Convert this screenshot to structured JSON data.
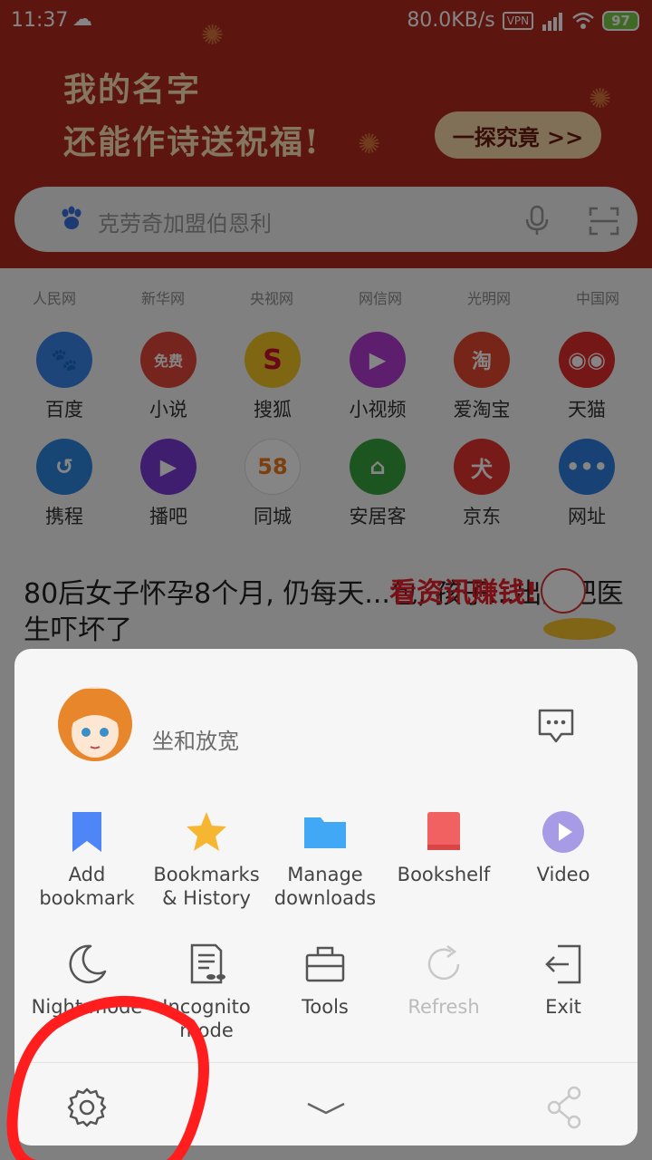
{
  "status_bar": {
    "time": "11:37",
    "speed": "80.0KB/s",
    "vpn": "VPN",
    "battery": "97"
  },
  "banner": {
    "line1": "我的名字",
    "line2": "还能作诗送祝福!",
    "button": "一探究竟 >>"
  },
  "search": {
    "placeholder": "克劳奇加盟伯恩利"
  },
  "quick_links": [
    "人民网",
    "新华网",
    "央视网",
    "网信网",
    "光明网",
    "中国网"
  ],
  "apps": [
    {
      "label": "百度",
      "color": "#3a85e8",
      "glyph": "🐾"
    },
    {
      "label": "小说",
      "color": "#e2473b",
      "glyph": "📖"
    },
    {
      "label": "搜狐",
      "color": "#f2c425",
      "glyph": "S"
    },
    {
      "label": "小视频",
      "color": "#b33ad2",
      "glyph": "▶"
    },
    {
      "label": "爱淘宝",
      "color": "#e54730",
      "glyph": "淘"
    },
    {
      "label": "天猫",
      "color": "#e02c2c",
      "glyph": "🐱"
    },
    {
      "label": "携程",
      "color": "#2e86de",
      "glyph": "🐬"
    },
    {
      "label": "播吧",
      "color": "#7a3ad6",
      "glyph": "▶"
    },
    {
      "label": "同城",
      "color": "#ffffff",
      "glyph": "58"
    },
    {
      "label": "安居客",
      "color": "#38a33e",
      "glyph": "⌂"
    },
    {
      "label": "京东",
      "color": "#e2352f",
      "glyph": "🐕"
    },
    {
      "label": "网址",
      "color": "#2f7fe0",
      "glyph": "•••"
    }
  ],
  "news": {
    "title": "80后女子怀孕8个月, 仍每天...包, 孩子...出生把医生吓坏了",
    "sticker_text": "看资讯赚钱!"
  },
  "menu": {
    "username": "坐和放宽",
    "items_row1": [
      {
        "label": "Add bookmark",
        "icon": "bookmark-icon"
      },
      {
        "label": "Bookmarks & History",
        "icon": "star-icon"
      },
      {
        "label": "Manage downloads",
        "icon": "folder-icon"
      },
      {
        "label": "Bookshelf",
        "icon": "book-icon"
      },
      {
        "label": "Video",
        "icon": "play-icon"
      }
    ],
    "items_row2": [
      {
        "label": "Night mode",
        "icon": "moon-icon"
      },
      {
        "label": "Incognito mode",
        "icon": "incognito-icon"
      },
      {
        "label": "Tools",
        "icon": "toolbox-icon"
      },
      {
        "label": "Refresh",
        "icon": "refresh-icon",
        "disabled": true
      },
      {
        "label": "Exit",
        "icon": "exit-icon"
      }
    ]
  },
  "colors": {
    "banner": "#b0291d",
    "bookmark_blue": "#4f86f7",
    "star_yellow": "#f7b632",
    "folder_blue": "#40a8f5",
    "book_red": "#f26161",
    "video_purple": "#a79be6",
    "annotation_red": "#ff1d1d"
  }
}
